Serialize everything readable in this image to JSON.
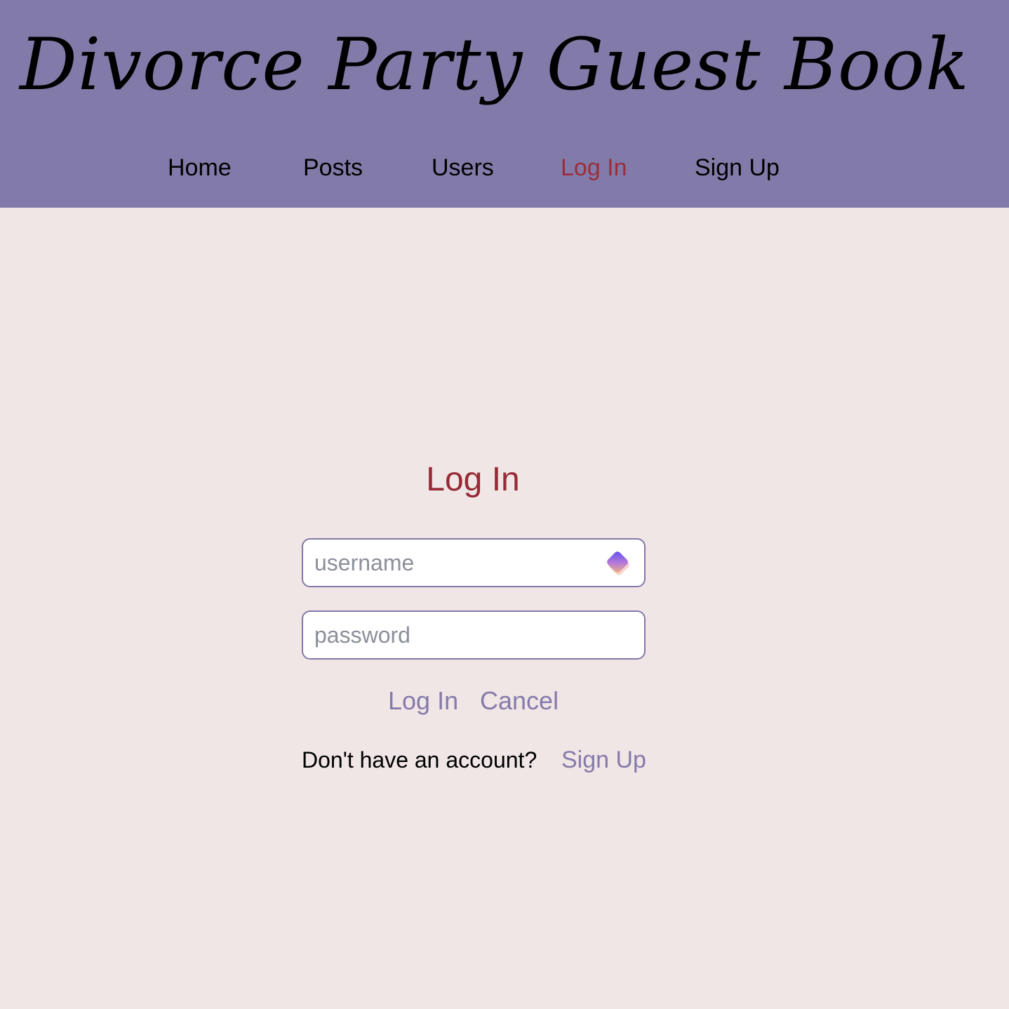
{
  "header": {
    "title": "Divorce Party Guest Book",
    "nav": [
      {
        "label": "Home"
      },
      {
        "label": "Posts"
      },
      {
        "label": "Users"
      },
      {
        "label": "Log In"
      },
      {
        "label": "Sign Up"
      }
    ],
    "active_nav": "Log In"
  },
  "login": {
    "title": "Log In",
    "username_placeholder": "username",
    "username_value": "",
    "password_placeholder": "password",
    "password_value": "",
    "submit_label": "Log In",
    "cancel_label": "Cancel",
    "signup_prompt": "Don't have an account?",
    "signup_link": "Sign Up"
  },
  "icons": {
    "password_manager": "password-manager-icon"
  },
  "colors": {
    "header_bg": "#827ba9",
    "page_bg": "#f0e6e6",
    "active_accent": "#9b2d3a",
    "link": "#857aab"
  }
}
